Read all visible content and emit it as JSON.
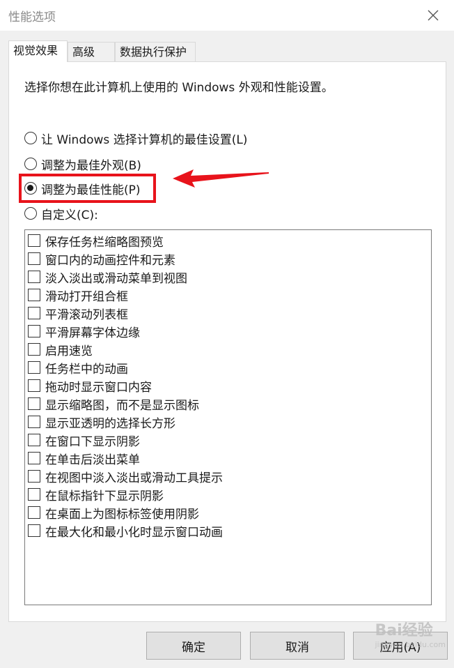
{
  "window": {
    "title": "性能选项",
    "close_icon": "close-icon"
  },
  "tabs": [
    {
      "label": "视觉效果",
      "active": true
    },
    {
      "label": "高级",
      "active": false
    },
    {
      "label": "数据执行保护",
      "active": false
    }
  ],
  "visual_effects": {
    "description": "选择你想在此计算机上使用的 Windows 外观和性能设置。",
    "radio_options": [
      {
        "label": "让 Windows 选择计算机的最佳设置(L)",
        "checked": false
      },
      {
        "label": "调整为最佳外观(B)",
        "checked": false
      },
      {
        "label": "调整为最佳性能(P)",
        "checked": true
      },
      {
        "label": "自定义(C):",
        "checked": false
      }
    ],
    "checkbox_items": [
      {
        "label": "保存任务栏缩略图预览",
        "checked": false
      },
      {
        "label": "窗口内的动画控件和元素",
        "checked": false
      },
      {
        "label": "淡入淡出或滑动菜单到视图",
        "checked": false
      },
      {
        "label": "滑动打开组合框",
        "checked": false
      },
      {
        "label": "平滑滚动列表框",
        "checked": false
      },
      {
        "label": "平滑屏幕字体边缘",
        "checked": false
      },
      {
        "label": "启用速览",
        "checked": false
      },
      {
        "label": "任务栏中的动画",
        "checked": false
      },
      {
        "label": "拖动时显示窗口内容",
        "checked": false
      },
      {
        "label": "显示缩略图，而不是显示图标",
        "checked": false
      },
      {
        "label": "显示亚透明的选择长方形",
        "checked": false
      },
      {
        "label": "在窗口下显示阴影",
        "checked": false
      },
      {
        "label": "在单击后淡出菜单",
        "checked": false
      },
      {
        "label": "在视图中淡入淡出或滑动工具提示",
        "checked": false
      },
      {
        "label": "在鼠标指针下显示阴影",
        "checked": false
      },
      {
        "label": "在桌面上为图标标签使用阴影",
        "checked": false
      },
      {
        "label": "在最大化和最小化时显示窗口动画",
        "checked": false
      }
    ]
  },
  "buttons": {
    "ok": "确定",
    "cancel": "取消",
    "apply": "应用(A)"
  },
  "annotation": {
    "highlight_color": "#e8131b"
  },
  "watermark": {
    "brand": "Bai经验",
    "sub": "jingyan.baidu.com"
  }
}
